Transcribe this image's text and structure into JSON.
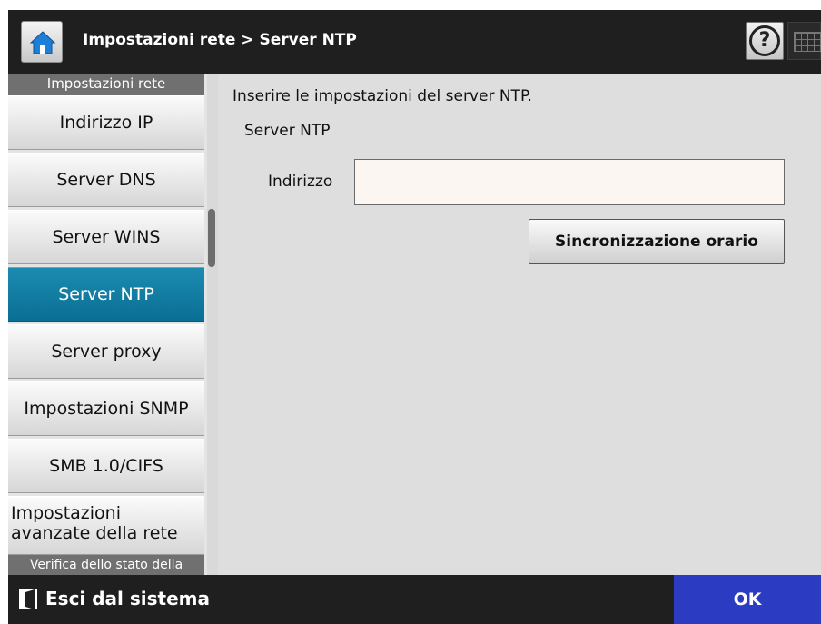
{
  "header": {
    "breadcrumb": "Impostazioni rete > Server NTP",
    "home_icon": "home-icon",
    "help_icon": "help-icon",
    "keyboard_icon": "keyboard-icon",
    "help_glyph": "?"
  },
  "sidebar": {
    "group_header": "Impostazioni rete",
    "items": [
      {
        "label": "Indirizzo IP",
        "active": false
      },
      {
        "label": "Server DNS",
        "active": false
      },
      {
        "label": "Server WINS",
        "active": false
      },
      {
        "label": "Server NTP",
        "active": true
      },
      {
        "label": "Server proxy",
        "active": false
      },
      {
        "label": "Impostazioni SNMP",
        "active": false
      },
      {
        "label": "SMB 1.0/CIFS",
        "active": false
      },
      {
        "label": "Impostazioni avanzate della rete",
        "active": false
      }
    ],
    "next_group_header": "Verifica dello stato della"
  },
  "main": {
    "instructions": "Inserire le impostazioni del server NTP.",
    "section_title": "Server NTP",
    "address_label": "Indirizzo",
    "address_value": "",
    "sync_button": "Sincronizzazione orario"
  },
  "footer": {
    "logout_label": "Esci dal sistema",
    "logout_icon": "logout-icon",
    "ok_label": "OK"
  },
  "colors": {
    "header_bg": "#1f1f1f",
    "active_item": "#0a6f94",
    "ok_button": "#2b3bc2",
    "main_bg": "#dedede"
  }
}
